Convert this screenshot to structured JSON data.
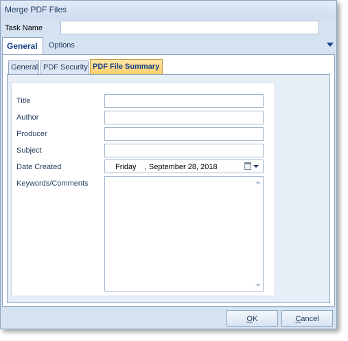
{
  "window": {
    "title": "Merge PDF Files"
  },
  "task": {
    "label": "Task Name",
    "value": ""
  },
  "outer_tabs": [
    {
      "label": "General",
      "active": true
    },
    {
      "label": "Options",
      "active": false
    }
  ],
  "inner_tabs": [
    {
      "label": "General",
      "active": false
    },
    {
      "label": "PDF Security",
      "active": false
    },
    {
      "label": "PDF File Summary",
      "active": true
    }
  ],
  "fields": {
    "title": {
      "label": "Title",
      "value": ""
    },
    "author": {
      "label": "Author",
      "value": ""
    },
    "producer": {
      "label": "Producer",
      "value": ""
    },
    "subject": {
      "label": "Subject",
      "value": ""
    },
    "date_created": {
      "label": "Date Created",
      "value": "Friday    , September 28, 2018"
    },
    "keywords": {
      "label": "Keywords/Comments",
      "value": ""
    }
  },
  "buttons": {
    "ok_mnemonic": "O",
    "ok_rest": "K",
    "cancel_mnemonic": "C",
    "cancel_rest": "ancel"
  },
  "icons": {
    "tabs_menu": "chevron-down-icon",
    "calendar": "calendar-icon",
    "date_dropdown": "dropdown-arrow-icon",
    "scroll_up": "scroll-up-arrow-icon",
    "scroll_down": "scroll-down-arrow-icon"
  },
  "colors": {
    "window_bg": "#d5e2f2",
    "active_subtab": "#ffcf6b",
    "text": "#1e395b"
  }
}
